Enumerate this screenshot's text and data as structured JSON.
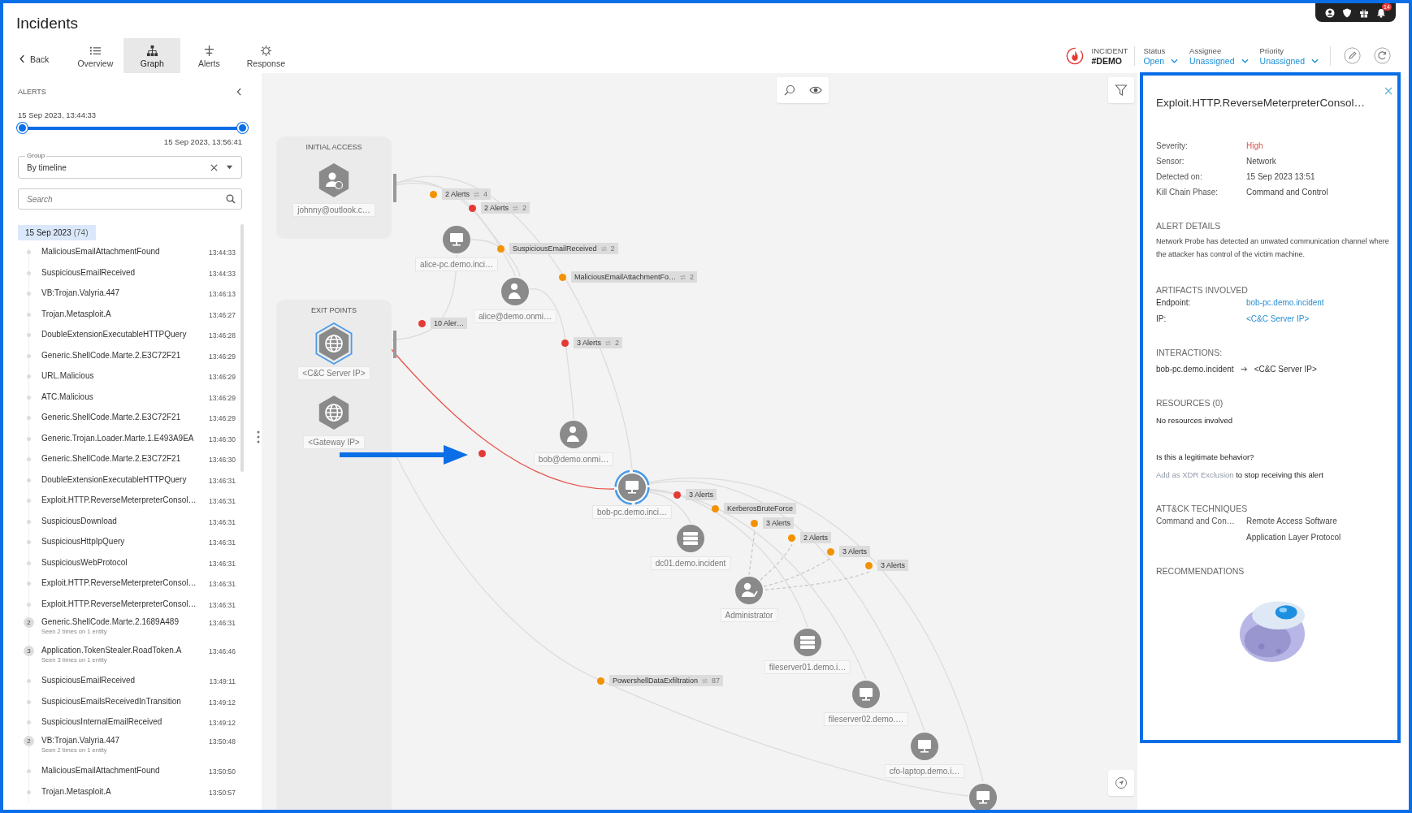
{
  "header": {
    "title": "Incidents",
    "back": "Back",
    "tabs": [
      {
        "label": "Overview",
        "kind": "overview",
        "selected": false
      },
      {
        "label": "Graph",
        "kind": "graph",
        "selected": true
      },
      {
        "label": "Alerts",
        "kind": "alerts",
        "selected": false
      },
      {
        "label": "Response",
        "kind": "response",
        "selected": false
      }
    ],
    "incident": {
      "label": "INCIDENT",
      "id": "#DEMO"
    },
    "fields": [
      {
        "label": "Status",
        "value": "Open"
      },
      {
        "label": "Assignee",
        "value": "Unassigned"
      },
      {
        "label": "Priority",
        "value": "Unassigned"
      }
    ],
    "notifications": {
      "count": "14"
    }
  },
  "alerts_panel": {
    "title": "ALERTS",
    "range_start": "15 Sep 2023, 13:44:33",
    "range_end": "15 Sep 2023, 13:56:41",
    "slider": {
      "level": 1
    },
    "group": {
      "label": "Group",
      "value": "By timeline"
    },
    "search": {
      "placeholder": "Search"
    },
    "date_group": {
      "date": "15 Sep 2023",
      "count": "(74)"
    },
    "items": [
      {
        "name": "MaliciousEmailAttachmentFound",
        "time": "13:44:33"
      },
      {
        "name": "SuspiciousEmailReceived",
        "time": "13:44:33"
      },
      {
        "name": "VB:Trojan.Valyria.447",
        "time": "13:46:13"
      },
      {
        "name": "Trojan.Metasploit.A",
        "time": "13:46:27"
      },
      {
        "name": "DoubleExtensionExecutableHTTPQuery",
        "time": "13:46:28"
      },
      {
        "name": "Generic.ShellCode.Marte.2.E3C72F21",
        "time": "13:46:29"
      },
      {
        "name": "URL.Malicious",
        "time": "13:46:29"
      },
      {
        "name": "ATC.Malicious",
        "time": "13:46:29"
      },
      {
        "name": "Generic.ShellCode.Marte.2.E3C72F21",
        "time": "13:46:29"
      },
      {
        "name": "Generic.Trojan.Loader.Marte.1.E493A9EA",
        "time": "13:46:30"
      },
      {
        "name": "Generic.ShellCode.Marte.2.E3C72F21",
        "time": "13:46:30"
      },
      {
        "name": "DoubleExtensionExecutableHTTPQuery",
        "time": "13:46:31"
      },
      {
        "name": "Exploit.HTTP.ReverseMeterpreterConsol…",
        "time": "13:46:31"
      },
      {
        "name": "SuspiciousDownload",
        "time": "13:46:31"
      },
      {
        "name": "SuspiciousHttpIpQuery",
        "time": "13:46:31"
      },
      {
        "name": "SuspiciousWebProtocol",
        "time": "13:46:31"
      },
      {
        "name": "Exploit.HTTP.ReverseMeterpreterConsol…",
        "time": "13:46:31"
      },
      {
        "name": "Exploit.HTTP.ReverseMeterpreterConsol…",
        "time": "13:46:31"
      },
      {
        "name": "Generic.ShellCode.Marte.2.1689A489",
        "time": "13:46:31",
        "repeat": "2",
        "note": "Seen 2 times on 1 entity"
      },
      {
        "name": "Application.TokenStealer.RoadToken.A",
        "time": "13:46:46",
        "repeat": "3",
        "note": "Seen 3 times on 1 entity"
      },
      {
        "name": "SuspiciousEmailReceived",
        "time": "13:49:11"
      },
      {
        "name": "SuspiciousEmailsReceivedInTransition",
        "time": "13:49:12"
      },
      {
        "name": "SuspiciousInternalEmailReceived",
        "time": "13:49:12"
      },
      {
        "name": "VB:Trojan.Valyria.447",
        "time": "13:50:48",
        "repeat": "2",
        "note": "Seen 2 times on 1 entity"
      },
      {
        "name": "MaliciousEmailAttachmentFound",
        "time": "13:50:50"
      },
      {
        "name": "Trojan.Metasploit.A",
        "time": "13:50:57"
      }
    ]
  },
  "graph": {
    "groups": [
      {
        "title": "INITIAL ACCESS",
        "nodes": [
          {
            "kind": "external-user",
            "label": "johnny@outlook.c…",
            "selected": false
          }
        ]
      },
      {
        "title": "EXIT POINTS",
        "nodes": [
          {
            "kind": "ip",
            "label": "<C&C Server IP>",
            "selected": true
          },
          {
            "kind": "ip",
            "label": "<Gateway IP>",
            "selected": false
          }
        ]
      }
    ],
    "nodes": [
      {
        "kind": "host",
        "label": "alice-pc.demo.inci…",
        "selected": false
      },
      {
        "kind": "user",
        "label": "alice@demo.onmi…",
        "selected": false
      },
      {
        "kind": "user",
        "label": "bob@demo.onmi…",
        "selected": false
      },
      {
        "kind": "host",
        "label": "bob-pc.demo.inci…",
        "selected": true
      },
      {
        "kind": "server",
        "label": "dc01.demo.incident",
        "selected": false
      },
      {
        "kind": "admin",
        "label": "Administrator",
        "selected": false
      },
      {
        "kind": "server",
        "label": "fileserver01.demo.i…",
        "selected": false
      },
      {
        "kind": "host",
        "label": "fileserver02.demo.…",
        "selected": false
      },
      {
        "kind": "host",
        "label": "cfo-laptop.demo.i…",
        "selected": false
      },
      {
        "kind": "host",
        "selected": false
      }
    ],
    "alerts": [
      {
        "label": "2 Alerts",
        "count": "4",
        "color": "#f39200"
      },
      {
        "label": "2 Alerts",
        "count": "2",
        "color": "#e53935"
      },
      {
        "label": "SuspiciousEmailReceived",
        "count": "2",
        "color": "#f39200"
      },
      {
        "label": "MaliciousEmailAttachmentFo…",
        "count": "2",
        "color": "#f39200"
      },
      {
        "label": "10 Aler…",
        "color": "#e53935"
      },
      {
        "label": "3 Alerts",
        "count": "2",
        "color": "#e53935"
      },
      {
        "color": "#e53935"
      },
      {
        "label": "3 Alerts",
        "color": "#e53935"
      },
      {
        "label": "KerberosBruteForce",
        "color": "#f39200"
      },
      {
        "label": "3 Alerts",
        "color": "#f39200"
      },
      {
        "label": "2 Alerts",
        "color": "#f39200"
      },
      {
        "label": "3 Alerts",
        "color": "#f39200"
      },
      {
        "label": "3 Alerts",
        "color": "#f39200"
      },
      {
        "label": "PowershellDataExfiltration",
        "count": "87",
        "color": "#f39200"
      }
    ]
  },
  "details": {
    "title": "Exploit.HTTP.ReverseMeterpreterConsol…",
    "facts": [
      {
        "label": "Severity:",
        "value": "High",
        "kind": "severity"
      },
      {
        "label": "Sensor:",
        "value": "Network",
        "kind": "text"
      },
      {
        "label": "Detected on:",
        "value": "15 Sep 2023 13:51",
        "kind": "text"
      },
      {
        "label": "Kill Chain Phase:",
        "value": "Command and Control",
        "kind": "text"
      }
    ],
    "alert_details": {
      "title": "ALERT DETAILS",
      "text": "Network Probe has detected an unwated communication channel where the attacker has control of the victim machine."
    },
    "artifacts": {
      "title": "ARTIFACTS INVOLVED",
      "rows": [
        {
          "label": "Endpoint:",
          "value": "bob-pc.demo.incident"
        },
        {
          "label": "IP:",
          "value": "<C&C Server IP>"
        }
      ]
    },
    "interactions": {
      "title": "INTERACTIONS:",
      "from": "bob-pc.demo.incident",
      "to": "<C&C Server IP>"
    },
    "resources": {
      "title": "RESOURCES (0)",
      "text": "No resources involved"
    },
    "question": "Is this a legitimate behavior?",
    "exclusion": {
      "link": "Add as XDR Exclusion",
      "text": "to stop receiving this alert"
    },
    "techniques": {
      "title": "ATT&CK TECHNIQUES",
      "rows": [
        {
          "tactic": "Command and Con…",
          "technique": "Remote Access Software"
        },
        {
          "technique": "Application Layer Protocol"
        }
      ]
    },
    "recommendations": {
      "title": "RECOMMENDATIONS"
    }
  }
}
